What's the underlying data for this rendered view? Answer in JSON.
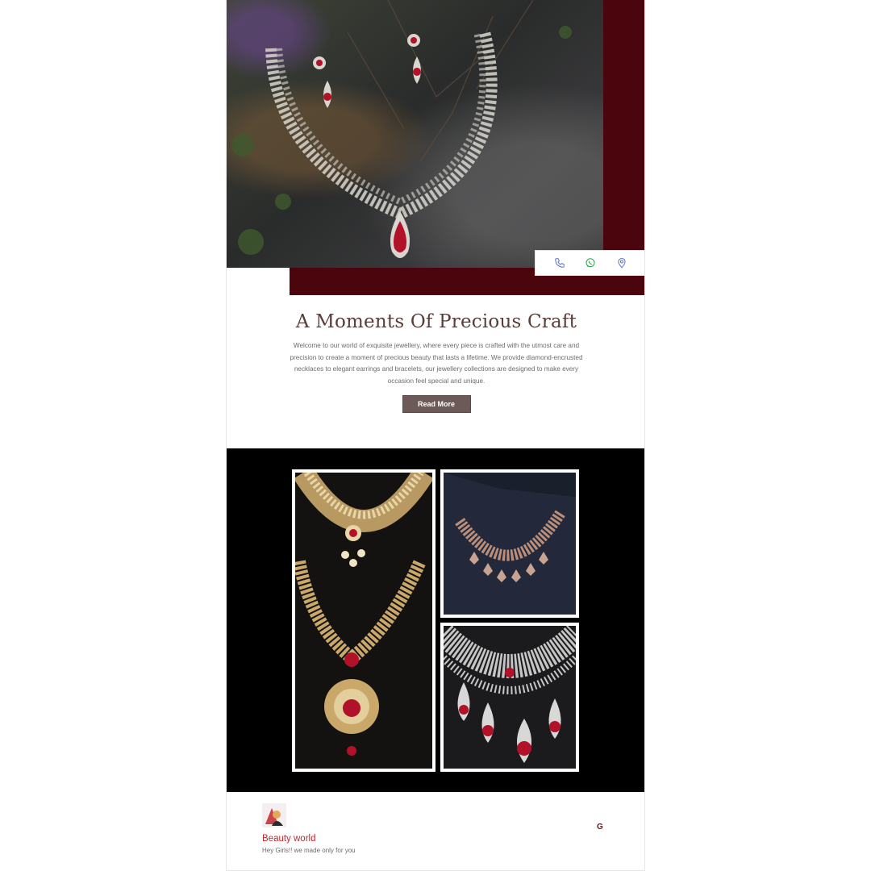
{
  "hero": {
    "image_label": "diamond-ruby-necklace-set",
    "accent_color": "#4a060c"
  },
  "contact": {
    "icons": [
      "phone-icon",
      "whatsapp-icon",
      "location-pin-icon"
    ],
    "colors": {
      "phone": "#5b6fd1",
      "whatsapp": "#2fa84f",
      "location": "#5b6fd1"
    }
  },
  "intro": {
    "title": "A Moments Of Precious Craft",
    "body": "Welcome to our world of exquisite jewellery, where every piece is crafted with the utmost care and precision to create a moment of precious beauty that lasts a lifetime. We provide diamond-encrusted necklaces to elegant earrings and bracelets, our jewellery collections are designed to make every occasion feel special and unique.",
    "button_label": "Read More"
  },
  "gallery": {
    "images": [
      "gold-ruby-long-necklace",
      "rose-gold-diamond-choker",
      "silver-diamond-ruby-necklace"
    ]
  },
  "footer": {
    "brand_name": "Beauty world",
    "tagline": "Hey Girls!! we made only for you",
    "g_icon_letter": "G"
  }
}
